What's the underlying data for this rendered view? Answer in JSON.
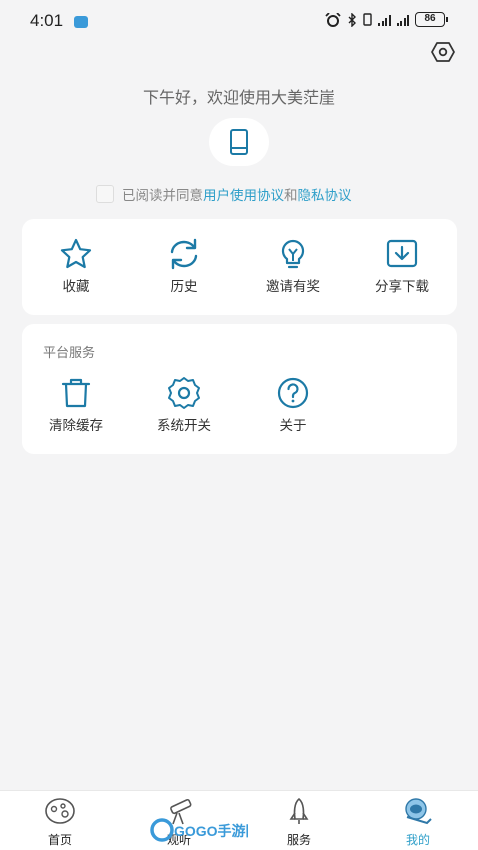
{
  "status": {
    "time": "4:01",
    "battery": "86"
  },
  "header": {
    "greeting": "下午好，欢迎使用大美茫崖"
  },
  "agreement": {
    "prefix": "已阅读并同意",
    "user_terms": "用户使用协议",
    "and": "和",
    "privacy": "隐私协议"
  },
  "quick_actions": [
    {
      "label": "收藏",
      "icon": "star-icon"
    },
    {
      "label": "历史",
      "icon": "refresh-icon"
    },
    {
      "label": "邀请有奖",
      "icon": "lightbulb-icon"
    },
    {
      "label": "分享下载",
      "icon": "download-icon"
    }
  ],
  "services": {
    "title": "平台服务",
    "items": [
      {
        "label": "清除缓存",
        "icon": "trash-icon"
      },
      {
        "label": "系统开关",
        "icon": "gear-icon"
      },
      {
        "label": "关于",
        "icon": "question-icon"
      }
    ]
  },
  "nav": {
    "items": [
      {
        "label": "首页",
        "icon": "planet-icon"
      },
      {
        "label": "观听",
        "icon": "telescope-icon"
      },
      {
        "label": "服务",
        "icon": "rocket-icon"
      },
      {
        "label": "我的",
        "icon": "astronaut-icon",
        "active": true
      }
    ],
    "watermark": "GOGO手游网"
  },
  "colors": {
    "accent": "#2f9fc9",
    "icon": "#1c7aa6",
    "background": "#f4f4f5"
  }
}
